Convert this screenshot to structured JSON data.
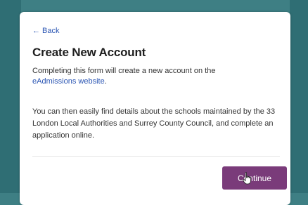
{
  "back": {
    "icon": "back-arrow-icon",
    "label": "Back"
  },
  "header": {
    "title": "Create New Account"
  },
  "intro": {
    "text_before_link": "Completing this form will create a new account on the",
    "link_text": "eAdmissions website",
    "text_after_link": "."
  },
  "details": {
    "text": "You can then easily find details about the schools maintained by the 33 London Local Authorities and Surrey County Council, and complete an application online."
  },
  "actions": {
    "continue_label": "Continue"
  },
  "colors": {
    "background": "#3e7f84",
    "link": "#2a55b3",
    "button": "#7a3b7a"
  }
}
